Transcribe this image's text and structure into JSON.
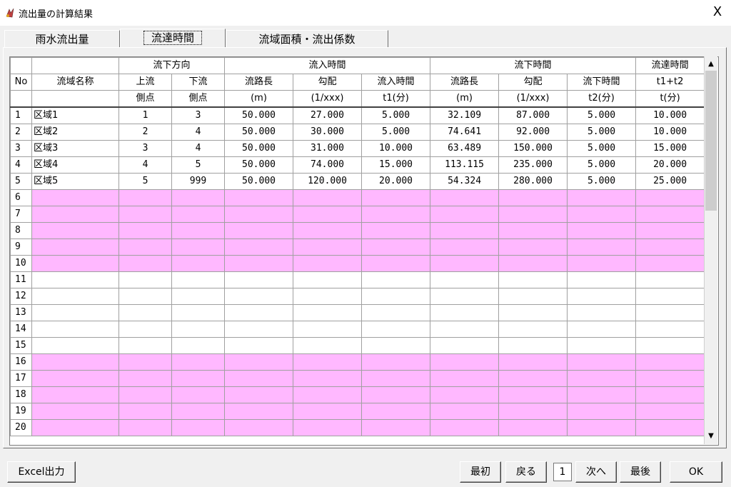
{
  "window": {
    "title": "流出量の計算結果",
    "close_label": "X"
  },
  "tabs": [
    {
      "label": "雨水流出量",
      "active": false
    },
    {
      "label": "流達時間",
      "active": true
    },
    {
      "label": "流域面積・流出係数",
      "active": false
    }
  ],
  "grid": {
    "group_headers": {
      "direction": "流下方向",
      "inflow": "流入時間",
      "flow": "流下時間",
      "arrival": "流達時間"
    },
    "columns": {
      "no": "No",
      "name": "流域名称",
      "upstream": [
        "上流",
        "側点"
      ],
      "downstream": [
        "下流",
        "側点"
      ],
      "in_length": [
        "流路長",
        "(m)"
      ],
      "in_slope": [
        "勾配",
        "(1/xxx)"
      ],
      "in_time": [
        "流入時間",
        "t1(分)"
      ],
      "fl_length": [
        "流路長",
        "(m)"
      ],
      "fl_slope": [
        "勾配",
        "(1/xxx)"
      ],
      "fl_time": [
        "流下時間",
        "t2(分)"
      ],
      "total": [
        "t1+t2",
        "t(分)"
      ]
    },
    "rows": [
      {
        "no": "1",
        "name": "区域1",
        "up": "1",
        "down": "3",
        "in_len": "50.000",
        "in_slope": "27.000",
        "in_time": "5.000",
        "fl_len": "32.109",
        "fl_slope": "87.000",
        "fl_time": "5.000",
        "total": "10.000"
      },
      {
        "no": "2",
        "name": "区域2",
        "up": "2",
        "down": "4",
        "in_len": "50.000",
        "in_slope": "30.000",
        "in_time": "5.000",
        "fl_len": "74.641",
        "fl_slope": "92.000",
        "fl_time": "5.000",
        "total": "10.000"
      },
      {
        "no": "3",
        "name": "区域3",
        "up": "3",
        "down": "4",
        "in_len": "50.000",
        "in_slope": "31.000",
        "in_time": "10.000",
        "fl_len": "63.489",
        "fl_slope": "150.000",
        "fl_time": "5.000",
        "total": "15.000"
      },
      {
        "no": "4",
        "name": "区域4",
        "up": "4",
        "down": "5",
        "in_len": "50.000",
        "in_slope": "74.000",
        "in_time": "15.000",
        "fl_len": "113.115",
        "fl_slope": "235.000",
        "fl_time": "5.000",
        "total": "20.000"
      },
      {
        "no": "5",
        "name": "区域5",
        "up": "5",
        "down": "999",
        "in_len": "50.000",
        "in_slope": "120.000",
        "in_time": "20.000",
        "fl_len": "54.324",
        "fl_slope": "280.000",
        "fl_time": "5.000",
        "total": "25.000"
      }
    ],
    "empty_rows": [
      {
        "no": "6",
        "color": "pink"
      },
      {
        "no": "7",
        "color": "pink"
      },
      {
        "no": "8",
        "color": "pink"
      },
      {
        "no": "9",
        "color": "pink"
      },
      {
        "no": "10",
        "color": "pink"
      },
      {
        "no": "11",
        "color": "white"
      },
      {
        "no": "12",
        "color": "white"
      },
      {
        "no": "13",
        "color": "white"
      },
      {
        "no": "14",
        "color": "white"
      },
      {
        "no": "15",
        "color": "white"
      },
      {
        "no": "16",
        "color": "pink"
      },
      {
        "no": "17",
        "color": "pink"
      },
      {
        "no": "18",
        "color": "pink"
      },
      {
        "no": "19",
        "color": "pink"
      },
      {
        "no": "20",
        "color": "pink"
      }
    ],
    "scroll_position": 0
  },
  "buttons": {
    "excel": "Excel出力",
    "first": "最初",
    "back": "戻る",
    "page": "1",
    "next": "次へ",
    "last": "最後",
    "ok": "OK"
  },
  "colors": {
    "highlight_rows": "#ffb8ff",
    "background": "#f0f0f0"
  }
}
